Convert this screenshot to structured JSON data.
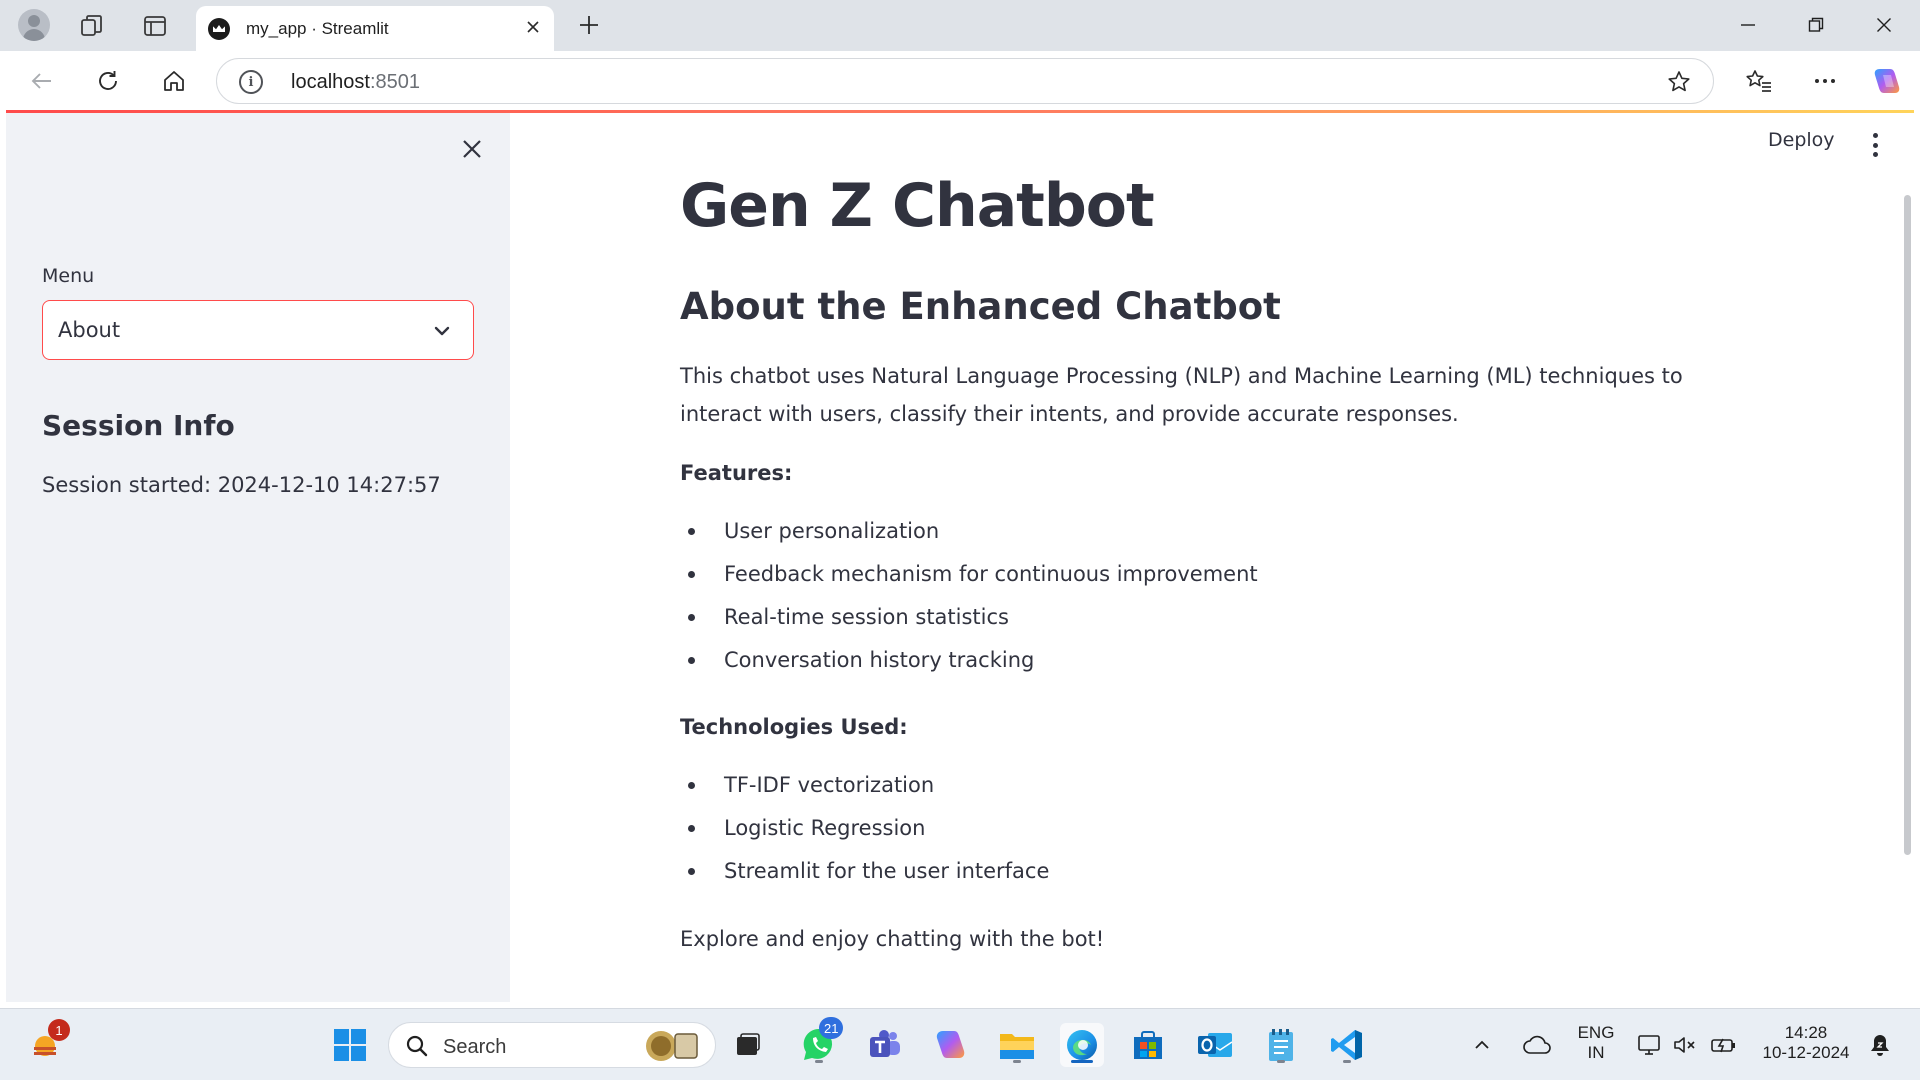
{
  "browser": {
    "tab_title": "my_app · Streamlit",
    "address_host": "localhost",
    "address_port": ":8501"
  },
  "sidebar": {
    "menu_label": "Menu",
    "menu_selected": "About",
    "session_heading": "Session Info",
    "session_started": "Session started: 2024-12-10 14:27:57"
  },
  "header": {
    "deploy_label": "Deploy"
  },
  "main": {
    "title": "Gen Z Chatbot",
    "subtitle": "About the Enhanced Chatbot",
    "description": "This chatbot uses Natural Language Processing (NLP) and Machine Learning (ML) techniques to interact with users, classify their intents, and provide accurate responses.",
    "features_label": "Features:",
    "features": [
      "User personalization",
      "Feedback mechanism for continuous improvement",
      "Real-time session statistics",
      "Conversation history tracking"
    ],
    "tech_label": "Technologies Used:",
    "technologies": [
      "TF-IDF vectorization",
      "Logistic Regression",
      "Streamlit for the user interface"
    ],
    "outro": "Explore and enjoy chatting with the bot!"
  },
  "taskbar": {
    "search_placeholder": "Search",
    "widgets_badge": "1",
    "whatsapp_badge": "21",
    "lang_top": "ENG",
    "lang_bottom": "IN",
    "time": "14:28",
    "date": "10-12-2024"
  },
  "colors": {
    "accent": "#ff4b4b",
    "sidebar_bg": "#f0f2f6",
    "text": "#31333f"
  }
}
